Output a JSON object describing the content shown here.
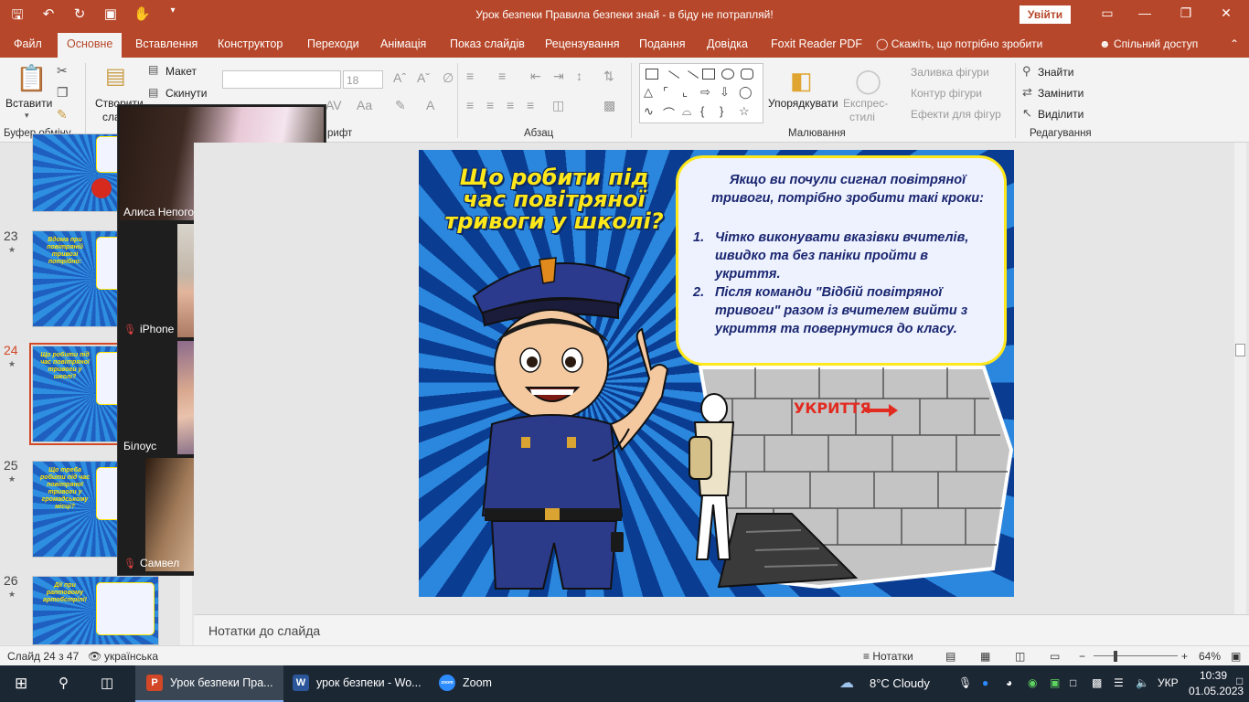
{
  "window": {
    "title": "Урок безпеки Правила безпеки знай - в біду не потрапляй!",
    "sign_in": "Увійти"
  },
  "ribbon_tabs": [
    "Файл",
    "Основне",
    "Вставлення",
    "Конструктор",
    "Переходи",
    "Анімація",
    "Показ слайдів",
    "Рецензування",
    "Подання",
    "Довідка",
    "Foxit Reader PDF"
  ],
  "active_tab": "Основне",
  "tell_me": "Скажіть, що потрібно зробити",
  "share": "Спільний доступ",
  "ribbon": {
    "paste": "Вставити",
    "clipboard_group": "Буфер обміну",
    "new_slide": "Створити",
    "new_slide_2": "сла",
    "layout": "Макет",
    "reset": "Скинути",
    "font_group": "рифт",
    "font_size": "18",
    "paragraph_group": "Абзац",
    "arrange": "Упорядкувати",
    "quick_styles": "Експрес-",
    "quick_styles_2": "стилі",
    "shape_fill": "Заливка фігури",
    "shape_outline": "Контур фігури",
    "shape_effects": "Ефекти для фігур",
    "drawing_group": "Малювання",
    "find": "Знайти",
    "replace": "Замінити",
    "select": "Виділити",
    "editing_group": "Редагування"
  },
  "thumbnails": [
    {
      "num": "23",
      "title": "Вдома при повітряній тривозі потрібно:",
      "selected": false
    },
    {
      "num": "24",
      "title": "Що робити під час повітряної тривоги у школі?",
      "selected": true
    },
    {
      "num": "25",
      "title": "Що треба робити під час повітряної тривоги у громадському місці?",
      "selected": false
    },
    {
      "num": "26",
      "title": "Дії при раптовому артобстрілі!",
      "selected": false
    }
  ],
  "zoom_participants": [
    {
      "name": "Алиса Непогодьева",
      "muted": false
    },
    {
      "name": "iPhone",
      "muted": true
    },
    {
      "name": "Білоус",
      "muted": false
    },
    {
      "name": "Самвел",
      "muted": true
    }
  ],
  "slide": {
    "heading": "Що робити під час повітряної тривоги у школі?",
    "intro": "Якщо ви почули сигнал повітряної тривоги, потрібно зробити такі кроки:",
    "steps": [
      {
        "num": "1.",
        "text": "Чітко виконувати вказівки вчителів, швидко та без паніки пройти в укриття."
      },
      {
        "num": "2.",
        "text": "Після команди \"Відбій повітряної тривоги\" разом із вчителем вийти з укриття та повернутися до класу."
      }
    ],
    "wall_sign": "УКРИТТЯ"
  },
  "notes_placeholder": "Нотатки до слайда",
  "status": {
    "slide_counter": "Слайд 24 з 47",
    "language": "українська",
    "notes_button": "Нотатки",
    "zoom_level": "64%"
  },
  "taskbar": {
    "apps": [
      {
        "label": "Урок безпеки Пра...",
        "icon": "P",
        "color": "#d24726",
        "active": true
      },
      {
        "label": "урок безпеки - Wo...",
        "icon": "W",
        "color": "#2b579a",
        "active": false
      },
      {
        "label": "Zoom",
        "icon": "zoom",
        "color": "#2d8cff",
        "active": false
      }
    ],
    "weather": "8°C  Cloudy",
    "keyboard": "УКР",
    "time": "10:39",
    "date": "01.05.2023"
  }
}
